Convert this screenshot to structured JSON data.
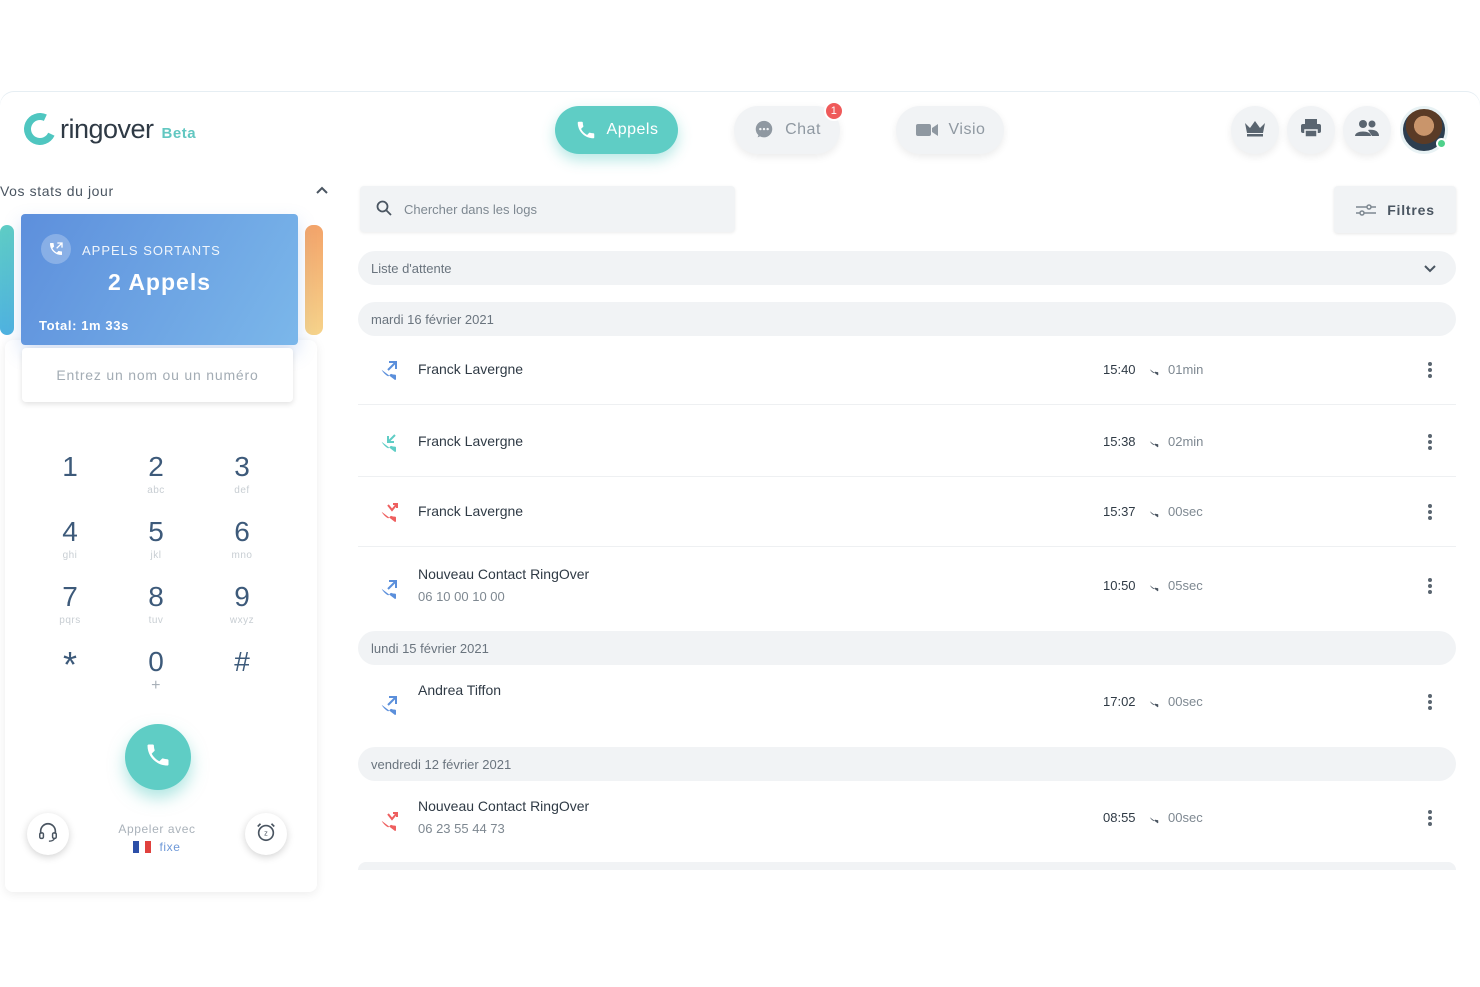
{
  "brand": {
    "name": "ringover",
    "tag": "Beta",
    "accent": "#5fcdc5"
  },
  "nav": {
    "appels": "Appels",
    "chat": "Chat",
    "chat_badge": "1",
    "visio": "Visio"
  },
  "header_icons": [
    "crown-icon",
    "print-icon",
    "people-icon"
  ],
  "stats": {
    "title": "Vos stats du jour",
    "card_label": "APPELS SORTANTS",
    "card_value": "2 Appels",
    "card_total": "Total: 1m 33s"
  },
  "dialer": {
    "placeholder": "Entrez un nom ou un numéro",
    "keys": [
      {
        "d": "1",
        "l": ""
      },
      {
        "d": "2",
        "l": "abc"
      },
      {
        "d": "3",
        "l": "def"
      },
      {
        "d": "4",
        "l": "ghi"
      },
      {
        "d": "5",
        "l": "jkl"
      },
      {
        "d": "6",
        "l": "mno"
      },
      {
        "d": "7",
        "l": "pqrs"
      },
      {
        "d": "8",
        "l": "tuv"
      },
      {
        "d": "9",
        "l": "wxyz"
      },
      {
        "d": "*",
        "l": ""
      },
      {
        "d": "0",
        "l": "+"
      },
      {
        "d": "#",
        "l": ""
      }
    ],
    "call_with_label": "Appeler avec",
    "call_with_value": "fixe"
  },
  "logs": {
    "search_placeholder": "Chercher dans les logs",
    "filters_label": "Filtres",
    "queue_label": "Liste d'attente",
    "groups": [
      {
        "date": "mardi 16 février 2021",
        "entries": [
          {
            "type": "outgoing",
            "name": "Franck Lavergne",
            "number": "",
            "time": "15:40",
            "duration": "01min"
          },
          {
            "type": "incoming",
            "name": "Franck Lavergne",
            "number": "",
            "time": "15:38",
            "duration": "02min"
          },
          {
            "type": "missed",
            "name": "Franck Lavergne",
            "number": "",
            "time": "15:37",
            "duration": "00sec"
          },
          {
            "type": "outgoing",
            "name": "Nouveau Contact RingOver",
            "number": "06 10 00 10 00",
            "time": "10:50",
            "duration": "05sec"
          }
        ]
      },
      {
        "date": "lundi 15 février 2021",
        "entries": [
          {
            "type": "outgoing",
            "name": "Andrea Tiffon",
            "number": "",
            "time": "17:02",
            "duration": "00sec"
          }
        ]
      },
      {
        "date": "vendredi 12 février 2021",
        "entries": [
          {
            "type": "missed",
            "name": "Nouveau Contact RingOver",
            "number": "06 23 55 44 73",
            "time": "08:55",
            "duration": "00sec"
          }
        ]
      }
    ]
  },
  "colors": {
    "outgoing": "#5b8fdb",
    "incoming": "#5fcdc5",
    "missed": "#ee5f5f"
  }
}
